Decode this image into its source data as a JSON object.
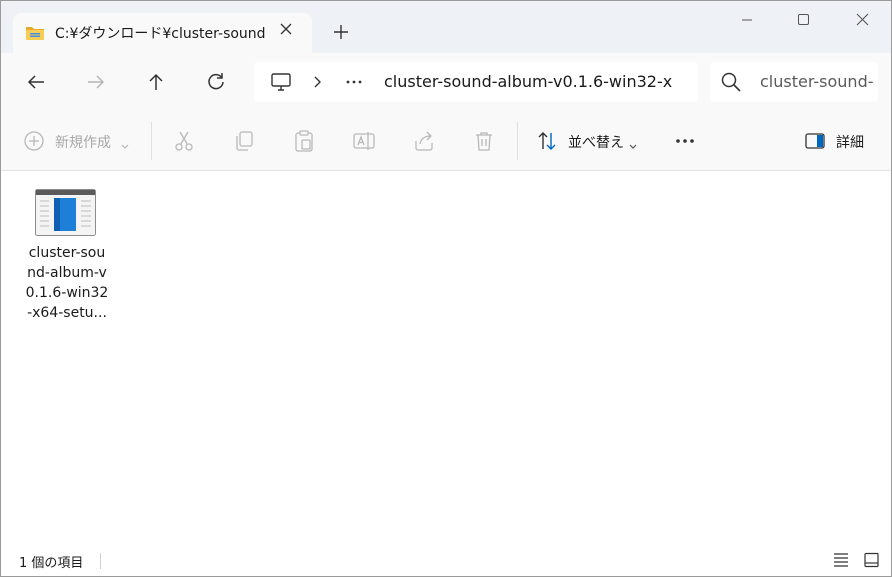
{
  "tab": {
    "title": "C:¥ダウンロード¥cluster-sound-al"
  },
  "address": {
    "path": "cluster-sound-album-v0.1.6-win32-x"
  },
  "search": {
    "placeholder": "cluster-sound-"
  },
  "toolbar": {
    "new_label": "新規作成",
    "sort_label": "並べ替え",
    "details_label": "詳細"
  },
  "files": [
    {
      "name": "cluster-sound-album-v0.1.6-win32-x64-setu..."
    }
  ],
  "status": {
    "count_text": "1 個の項目"
  },
  "colors": {
    "accent": "#0067c0",
    "folder": "#f3c13a",
    "titlebar": "#eef1f6"
  }
}
